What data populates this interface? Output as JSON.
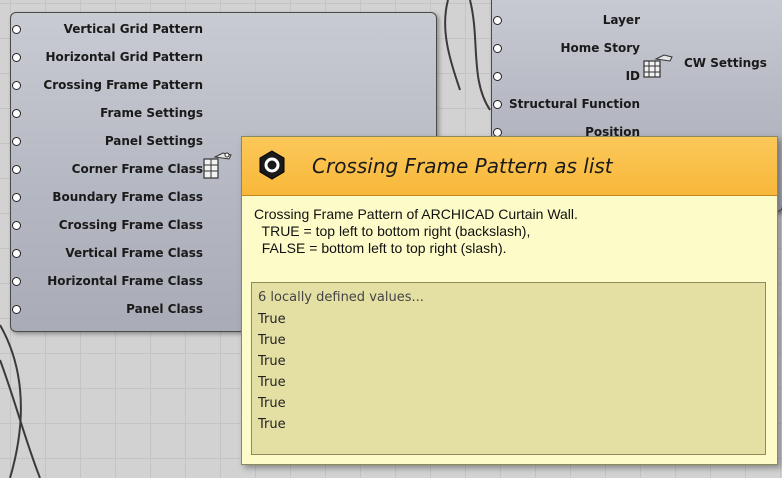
{
  "left_component": {
    "inputs": [
      "Vertical Grid Pattern",
      "Horizontal Grid Pattern",
      "Crossing Frame Pattern",
      "Frame Settings",
      "Panel Settings",
      "Corner Frame Class",
      "Boundary Frame Class",
      "Crossing Frame Class",
      "Vertical Frame Class",
      "Horizontal Frame Class",
      "Panel Class"
    ],
    "icon": "curtain-wall-settings-icon"
  },
  "right_component": {
    "inputs": [
      "Layer",
      "Home Story",
      "ID",
      "Structural Function",
      "Position"
    ],
    "output_label": "CW Settings",
    "icon": "curtain-wall-grid-icon"
  },
  "tooltip": {
    "title": "Crossing Frame Pattern as list",
    "description": [
      "Crossing Frame Pattern of ARCHICAD Curtain Wall.",
      "  TRUE = top left to bottom right (backslash),",
      "  FALSE = bottom left to top right (slash)."
    ],
    "values_header": "6 locally defined values...",
    "values": [
      "True",
      "True",
      "True",
      "True",
      "True",
      "True"
    ],
    "icon": "hexagon-parameter-icon",
    "header_color": "#f9be45",
    "body_color": "#fdfbc8"
  }
}
